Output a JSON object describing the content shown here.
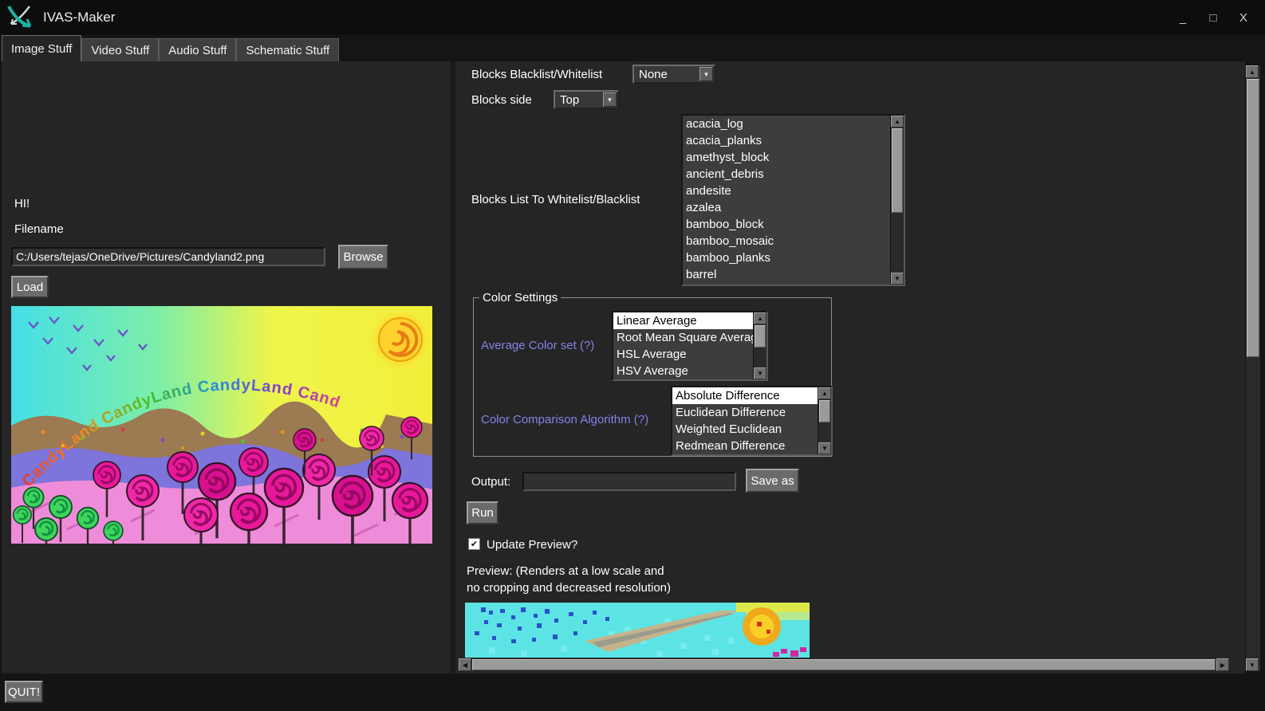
{
  "window": {
    "title": "IVAS-Maker",
    "minimize": "_",
    "maximize": "□",
    "close": "X"
  },
  "icons": {
    "up": "▲",
    "down": "▼",
    "left": "◀",
    "right": "▶",
    "check": "✔"
  },
  "colors": {
    "accent_purple": "#8682e8",
    "selection_bg": "#ffffff",
    "panel_bg": "#252525"
  },
  "tabs": {
    "t0": "Image Stuff",
    "t1": "Video Stuff",
    "t2": "Audio Stuff",
    "t3": "Schematic Stuff"
  },
  "left_panel": {
    "hi": "HI!",
    "filename_label": "Filename",
    "filename_value": "C:/Users/tejas/OneDrive/Pictures/Candyland2.png",
    "browse": "Browse",
    "load": "Load",
    "image_text": "CandyLand CandyLand CandyLand Cand"
  },
  "right_panel": {
    "blacklist_label": "Blocks Blacklist/Whitelist",
    "blacklist_value": "None",
    "side_label": "Blocks side",
    "side_value": "Top",
    "blocks_label": "Blocks List To Whitelist/Blacklist",
    "blocks": [
      "acacia_log",
      "acacia_planks",
      "amethyst_block",
      "ancient_debris",
      "andesite",
      "azalea",
      "bamboo_block",
      "bamboo_mosaic",
      "bamboo_planks",
      "barrel"
    ],
    "color_settings": {
      "title": "Color Settings",
      "avg_label": "Average Color set (?)",
      "avg_options": [
        "Linear Average",
        "Root Mean Square Average",
        "HSL Average",
        "HSV Average"
      ],
      "avg_selected": "Linear Average",
      "cmp_label": "Color Comparison Algorithm (?)",
      "cmp_options": [
        "Absolute Difference",
        "Euclidean Difference",
        "Weighted Euclidean",
        "Redmean Difference"
      ],
      "cmp_selected": "Absolute Difference"
    },
    "output_label": "Output:",
    "output_value": "",
    "save_as": "Save as",
    "run": "Run",
    "update_preview": "Update Preview?",
    "preview_line1": "Preview: (Renders at a low scale and",
    "preview_line2": "no cropping and decreased resolution)"
  },
  "footer": {
    "quit": "QUIT!"
  }
}
